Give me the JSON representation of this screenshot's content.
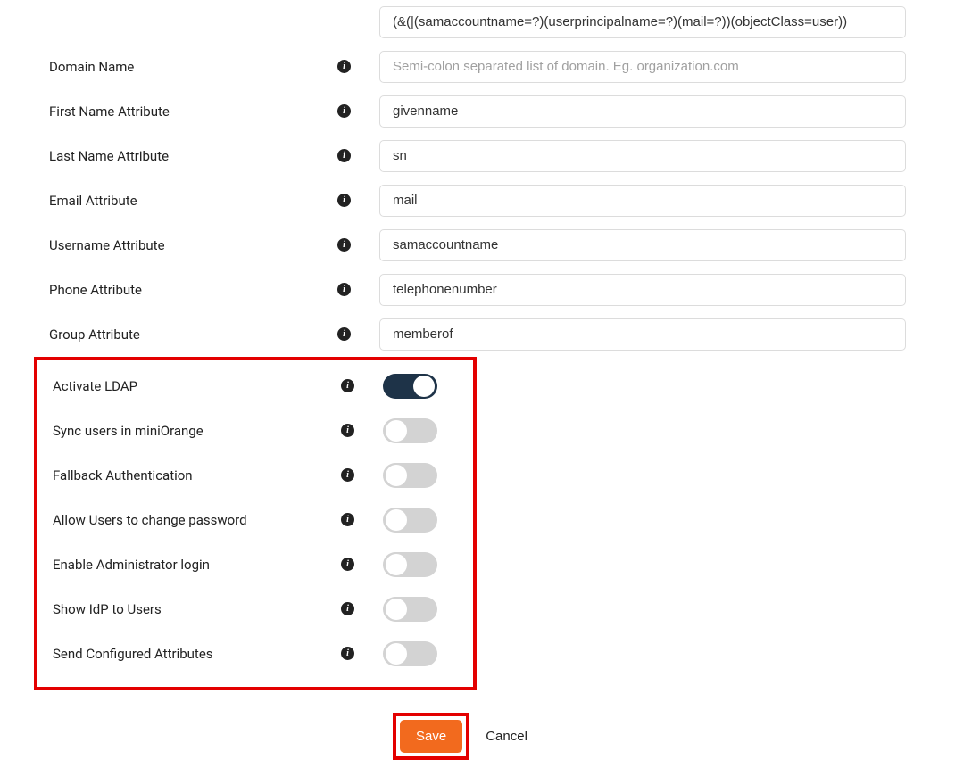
{
  "fields": {
    "search_filter": {
      "value": "(&(|(samaccountname=?)(userprincipalname=?)(mail=?))(objectClass=user))"
    },
    "domain_name": {
      "label": "Domain Name",
      "value": "",
      "placeholder": "Semi-colon separated list of domain. Eg. organization.com"
    },
    "first_name_attr": {
      "label": "First Name Attribute",
      "value": "givenname"
    },
    "last_name_attr": {
      "label": "Last Name Attribute",
      "value": "sn"
    },
    "email_attr": {
      "label": "Email Attribute",
      "value": "mail"
    },
    "username_attr": {
      "label": "Username Attribute",
      "value": "samaccountname"
    },
    "phone_attr": {
      "label": "Phone Attribute",
      "value": "telephonenumber"
    },
    "group_attr": {
      "label": "Group Attribute",
      "value": "memberof"
    }
  },
  "toggles": {
    "activate_ldap": {
      "label": "Activate LDAP",
      "on": true
    },
    "sync_users": {
      "label": "Sync users in miniOrange",
      "on": false
    },
    "fallback_auth": {
      "label": "Fallback Authentication",
      "on": false
    },
    "allow_change_pw": {
      "label": "Allow Users to change password",
      "on": false
    },
    "enable_admin_login": {
      "label": "Enable Administrator login",
      "on": false
    },
    "show_idp": {
      "label": "Show IdP to Users",
      "on": false
    },
    "send_config_attrs": {
      "label": "Send Configured Attributes",
      "on": false
    }
  },
  "footer": {
    "save": "Save",
    "cancel": "Cancel"
  },
  "info_glyph": "i"
}
